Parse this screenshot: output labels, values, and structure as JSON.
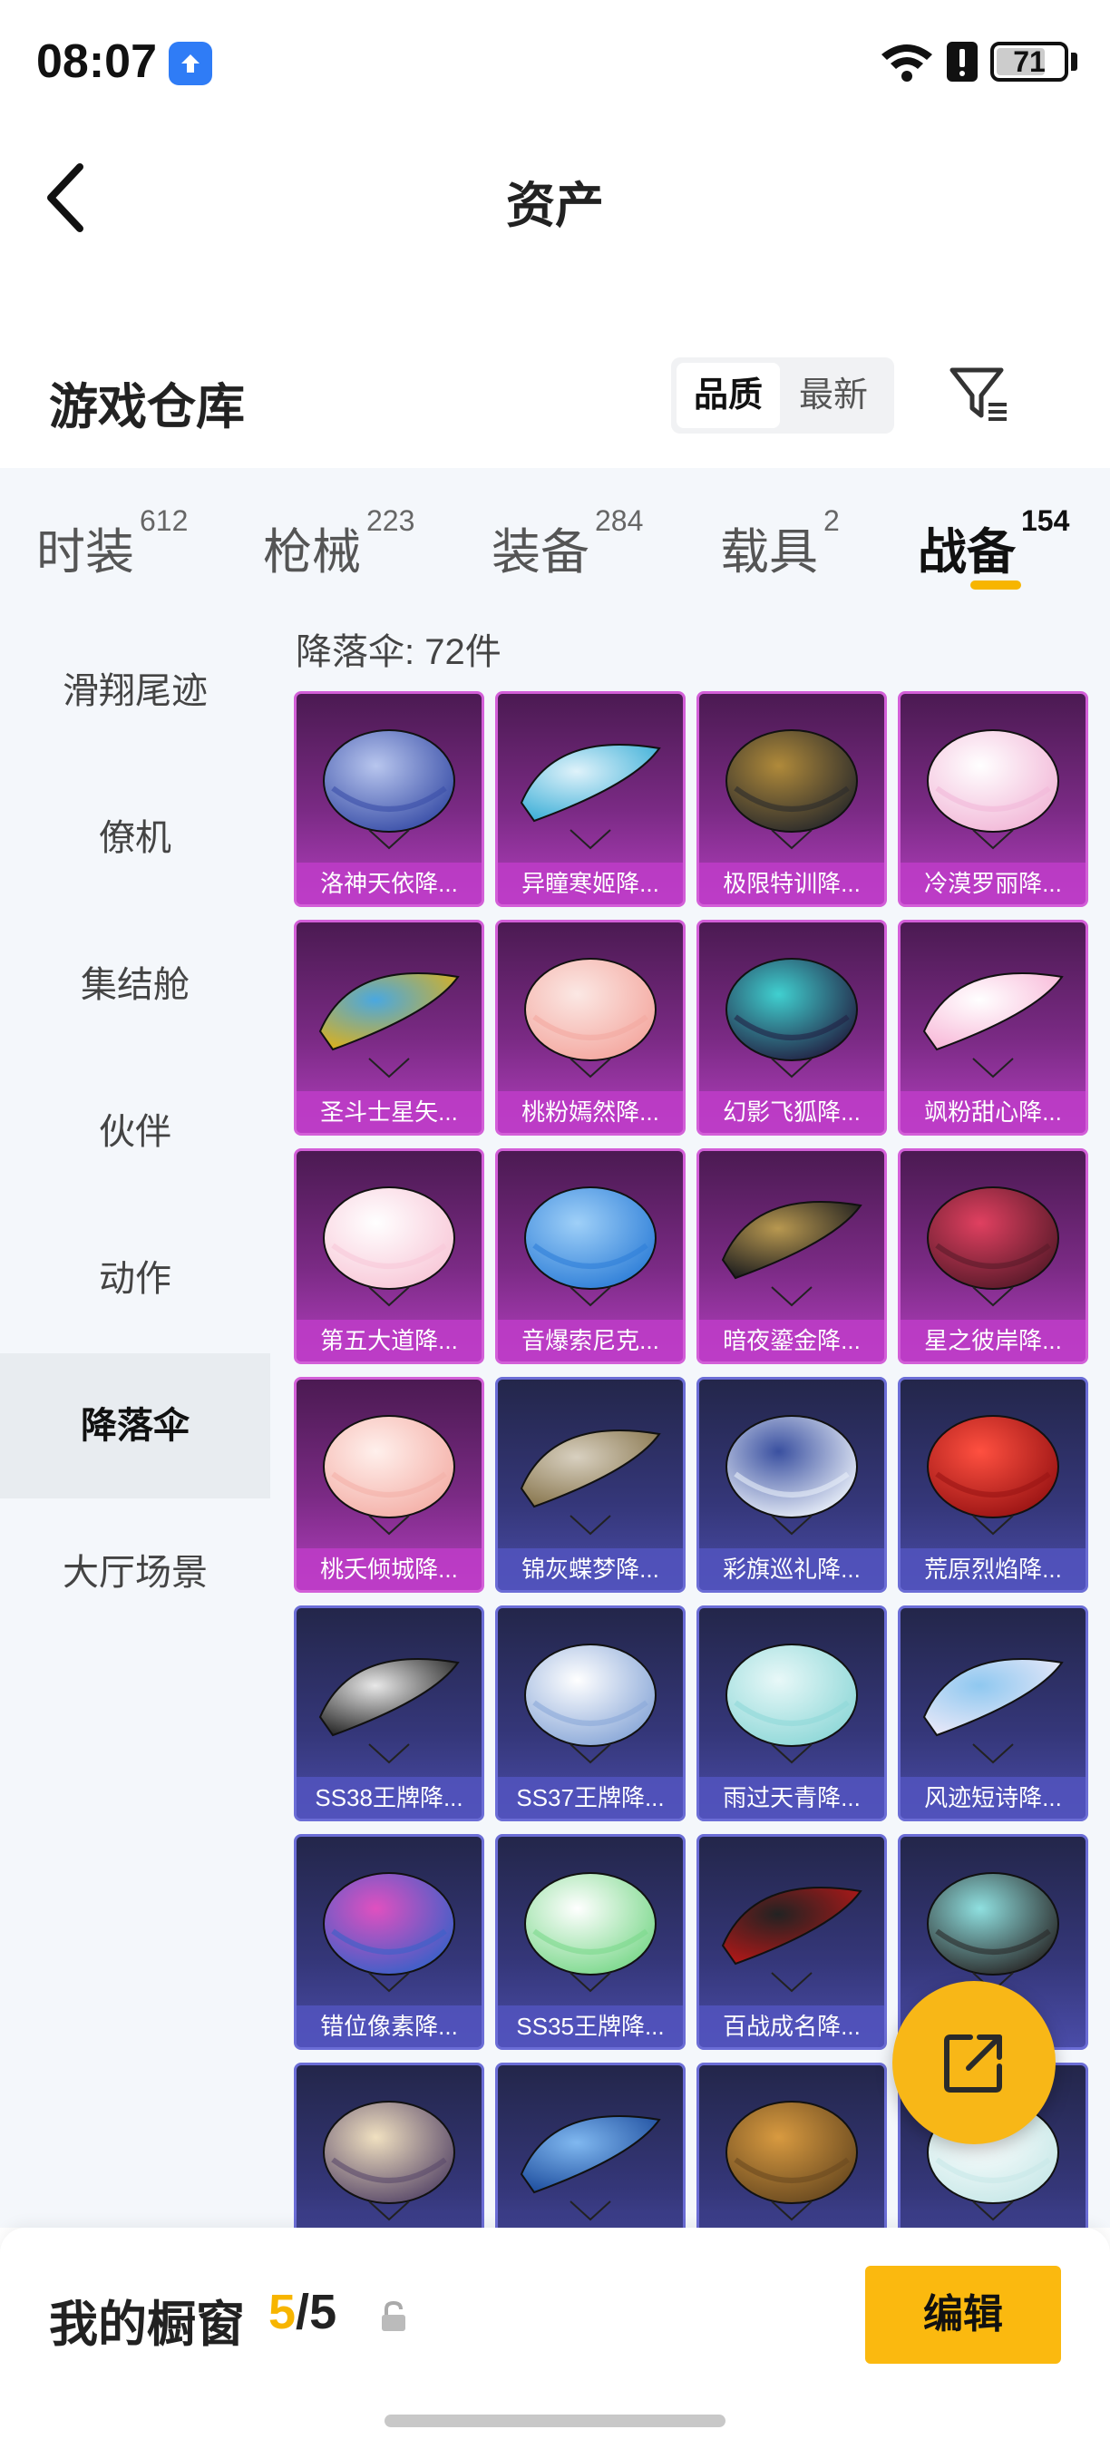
{
  "status_bar": {
    "time": "08:07",
    "battery": "71",
    "battery_level": 0.71
  },
  "nav": {
    "title": "资产"
  },
  "warehouse": {
    "title": "游戏仓库",
    "sort_options": [
      {
        "label": "品质",
        "active": true
      },
      {
        "label": "最新",
        "active": false
      }
    ]
  },
  "tabs": [
    {
      "label": "时装",
      "count": "612"
    },
    {
      "label": "枪械",
      "count": "223"
    },
    {
      "label": "装备",
      "count": "284"
    },
    {
      "label": "载具",
      "count": "2"
    },
    {
      "label": "战备",
      "count": "154",
      "active": true
    }
  ],
  "sidebar": {
    "items": [
      {
        "label": "滑翔尾迹"
      },
      {
        "label": "僚机"
      },
      {
        "label": "集结舱"
      },
      {
        "label": "伙伴"
      },
      {
        "label": "动作"
      },
      {
        "label": "降落伞",
        "active": true
      },
      {
        "label": "大厅场景"
      }
    ]
  },
  "content": {
    "count_label": "降落伞: 72件",
    "items": [
      {
        "name": "洛神天依降...",
        "rarity": "pink",
        "colors": [
          "#3a4fa8",
          "#b8c6ee"
        ]
      },
      {
        "name": "异瞳寒姬降...",
        "rarity": "pink",
        "colors": [
          "#3fb0d8",
          "#dff2fa"
        ]
      },
      {
        "name": "极限特训降...",
        "rarity": "pink",
        "colors": [
          "#2b2b2b",
          "#b08a3a"
        ]
      },
      {
        "name": "冷漠罗丽降...",
        "rarity": "pink",
        "colors": [
          "#f2b8d8",
          "#ffffff"
        ]
      },
      {
        "name": "圣斗士星矢...",
        "rarity": "pink",
        "colors": [
          "#d8b020",
          "#4aa8e0"
        ]
      },
      {
        "name": "桃粉嫣然降...",
        "rarity": "pink",
        "colors": [
          "#f4a8a0",
          "#fbe8e4"
        ]
      },
      {
        "name": "幻影飞狐降...",
        "rarity": "pink",
        "colors": [
          "#222244",
          "#40d0d0"
        ]
      },
      {
        "name": "飒粉甜心降...",
        "rarity": "pink",
        "colors": [
          "#f8b8d8",
          "#ffffff"
        ]
      },
      {
        "name": "第五大道降...",
        "rarity": "pink",
        "colors": [
          "#f8c8d8",
          "#ffffff"
        ]
      },
      {
        "name": "音爆索尼克...",
        "rarity": "pink",
        "colors": [
          "#2f7fd8",
          "#9fd0f8"
        ]
      },
      {
        "name": "暗夜鎏金降...",
        "rarity": "pink",
        "colors": [
          "#1f1f1f",
          "#b89850"
        ]
      },
      {
        "name": "星之彼岸降...",
        "rarity": "pink",
        "colors": [
          "#5a1a2a",
          "#e04060"
        ]
      },
      {
        "name": "桃夭倾城降...",
        "rarity": "pink",
        "colors": [
          "#f4b0a8",
          "#fff0ec"
        ]
      },
      {
        "name": "锦灰蝶梦降...",
        "rarity": "blue",
        "colors": [
          "#8a7850",
          "#d8d0c0"
        ]
      },
      {
        "name": "彩旗巡礼降...",
        "rarity": "blue",
        "colors": [
          "#e8eef8",
          "#3a50a0"
        ]
      },
      {
        "name": "荒原烈焰降...",
        "rarity": "blue",
        "colors": [
          "#9a1414",
          "#ff5040"
        ]
      },
      {
        "name": "SS38王牌降...",
        "rarity": "blue",
        "colors": [
          "#2a2a2a",
          "#e8e8e8"
        ]
      },
      {
        "name": "SS37王牌降...",
        "rarity": "blue",
        "colors": [
          "#8aa8d8",
          "#ffffff"
        ]
      },
      {
        "name": "雨过天青降...",
        "rarity": "blue",
        "colors": [
          "#8fd8d8",
          "#e8f8f8"
        ]
      },
      {
        "name": "风迹短诗降...",
        "rarity": "blue",
        "colors": [
          "#e8e8f8",
          "#8fc8f0"
        ]
      },
      {
        "name": "错位像素降...",
        "rarity": "blue",
        "colors": [
          "#3a60c8",
          "#e050c0"
        ]
      },
      {
        "name": "SS35王牌降...",
        "rarity": "blue",
        "colors": [
          "#7cd88c",
          "#ffffff"
        ]
      },
      {
        "name": "百战成名降...",
        "rarity": "blue",
        "colors": [
          "#b01818",
          "#222222"
        ]
      },
      {
        "name": "",
        "rarity": "blue",
        "colors": [
          "#2a2a2a",
          "#8fe0e0"
        ]
      },
      {
        "name": "",
        "rarity": "blue",
        "colors": [
          "#5a4a6a",
          "#f0e0c0"
        ]
      },
      {
        "name": "",
        "rarity": "blue",
        "colors": [
          "#2050a0",
          "#80b8f0"
        ]
      },
      {
        "name": "",
        "rarity": "blue",
        "colors": [
          "#6a4a20",
          "#d89a40"
        ]
      },
      {
        "name": "",
        "rarity": "blue",
        "colors": [
          "#c8e8e8",
          "#ffffff"
        ]
      }
    ]
  },
  "showcase": {
    "label": "我的橱窗",
    "current": "5",
    "separator": "/",
    "total": "5",
    "edit_label": "编辑"
  },
  "icons": {
    "back": "back-chevron-icon",
    "filter": "filter-funnel-icon",
    "share": "share-external-icon",
    "lock": "lock-icon"
  },
  "colors": {
    "accent": "#f7b500",
    "rare_pink": "#b23fbe",
    "rare_blue": "#4a4ca8"
  }
}
